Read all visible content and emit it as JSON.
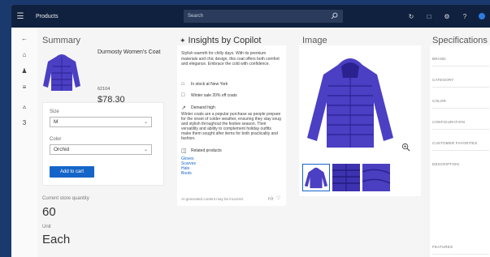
{
  "header": {
    "title": "Products",
    "search_placeholder": "Search"
  },
  "summary": {
    "heading": "Summary",
    "product_name": "Durmosty Women's Coat",
    "product_id": "62104",
    "price": "$78.30",
    "size_label": "Size",
    "size_value": "M",
    "color_label": "Color",
    "color_value": "Orchid",
    "add_to_cart": "Add to cart",
    "qty_label": "Current store quantity",
    "qty_value": "60",
    "unit_label": "Unit",
    "unit_value": "Each"
  },
  "insights": {
    "heading": "Insights by Copilot",
    "description": "Stylish warmth for chilly days. With its premium materials and chic design, this coat offers both comfort and elegance. Embrace the cold with confidence.",
    "stock": "In stock at New York",
    "sale": "Winter sale 20% off coats",
    "demand_title": "Demand high",
    "demand_text": "Winter coats are a popular purchase as people prepare for the onset of colder weather, ensuring they stay snug and stylish throughout the festive season. Their versatility and ability to complement holiday outfits make them sought after items for both practicality and fashion.",
    "related_title": "Related products",
    "related": [
      "Gloves",
      "Scarves",
      "Hats",
      "Boots"
    ],
    "ai_note": "AI-generated content may be incorrect"
  },
  "image": {
    "heading": "Image"
  },
  "specifications": {
    "heading": "Specifications",
    "items": [
      "BRAND",
      "CATEGORY",
      "COLOR",
      "CONFIGURATION",
      "CUSTOMER FAVORITES",
      "DESCRIPTION",
      "FEATURES"
    ]
  },
  "colors": {
    "accent": "#1565c8",
    "topbar": "#10213f",
    "coat": "#4b3fc4"
  }
}
